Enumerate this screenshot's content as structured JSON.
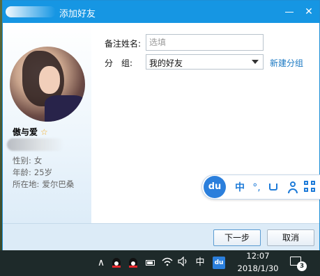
{
  "window": {
    "title": "添加好友",
    "minimize_glyph": "—",
    "close_glyph": "✕"
  },
  "profile": {
    "nickname": "傲与爱",
    "gender_label": "性别:",
    "gender_value": "女",
    "age_label": "年龄:",
    "age_value": "25岁",
    "location_label": "所在地:",
    "location_value": "爱尔巴桑"
  },
  "form": {
    "remark_label": "备注姓名:",
    "remark_placeholder": "选填",
    "remark_value": "",
    "group_label": "分　组:",
    "group_value": "我的好友",
    "new_group_link": "新建分组"
  },
  "footer": {
    "next_label": "下一步",
    "cancel_label": "取消"
  },
  "du_toolbar": {
    "logo": "du",
    "ime_mode": "中",
    "punctuation": "°,"
  },
  "taskbar": {
    "up_arrow": "∧",
    "ime": "中",
    "du_label": "du",
    "time": "12:07",
    "date": "2018/1/30",
    "notification_count": "3"
  },
  "colors": {
    "titlebar": "#1696e3",
    "link": "#1a78c2",
    "footer": "#dcebf7",
    "du_accent": "#2b7fdc",
    "star": "#f2a81d"
  }
}
